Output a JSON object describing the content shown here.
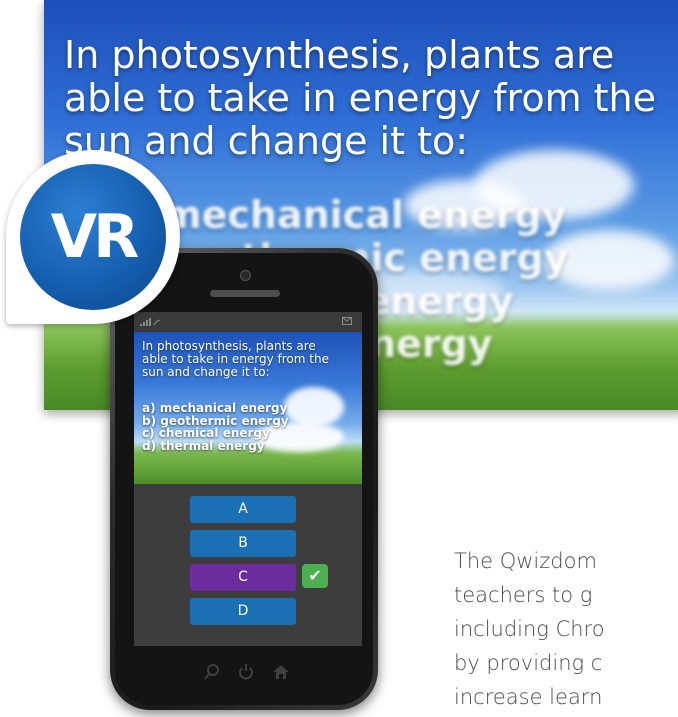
{
  "slide": {
    "question_lines": [
      "In photosynthesis, plants are",
      "able to take in energy from the",
      "sun and change it to:"
    ],
    "options": [
      "mechanical energy",
      "geothermic energy",
      "chemical energy",
      "thermal energy"
    ]
  },
  "badge": {
    "label": "VR",
    "color": "#155fb0"
  },
  "phone": {
    "question_lines": [
      "In photosynthesis, plants are",
      "able to take in energy from the",
      "sun and change it to:"
    ],
    "options": [
      "a) mechanical energy",
      "b) geothermic energy",
      "c) chemical energy",
      "d) thermal energy"
    ],
    "answers": [
      {
        "label": "A",
        "selected": false
      },
      {
        "label": "B",
        "selected": false
      },
      {
        "label": "C",
        "selected": true
      },
      {
        "label": "D",
        "selected": false
      }
    ],
    "check_icon": "✔",
    "status_icons": [
      "signal-icon",
      "mail-icon"
    ],
    "home_icons": [
      "search-icon",
      "power-icon",
      "home-icon"
    ],
    "colors": {
      "answer": "#1a6fb5",
      "selected": "#6b2d9e",
      "check": "#4caf50"
    }
  },
  "body_text": [
    "The Qwizdom",
    "teachers to g",
    "including Chro",
    "by providing c",
    "increase learn"
  ]
}
